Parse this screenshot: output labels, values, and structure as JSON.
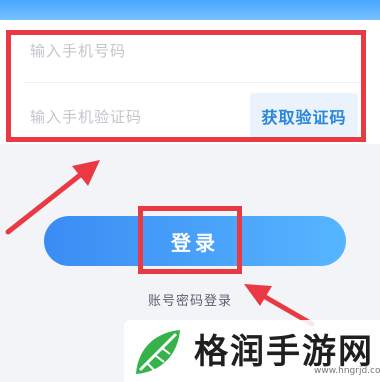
{
  "form": {
    "phone_placeholder": "输入手机号码",
    "code_placeholder": "输入手机验证码",
    "get_code_label": "获取验证码"
  },
  "login": {
    "button_label": "登录",
    "account_login_label": "账号密码登录"
  },
  "watermark": {
    "brand": "格润手游网",
    "url": "www.hngrjd.com"
  },
  "colors": {
    "highlight": "#e93a43",
    "accent": "#3a8cf3",
    "get_code_text": "#2b86d8"
  }
}
